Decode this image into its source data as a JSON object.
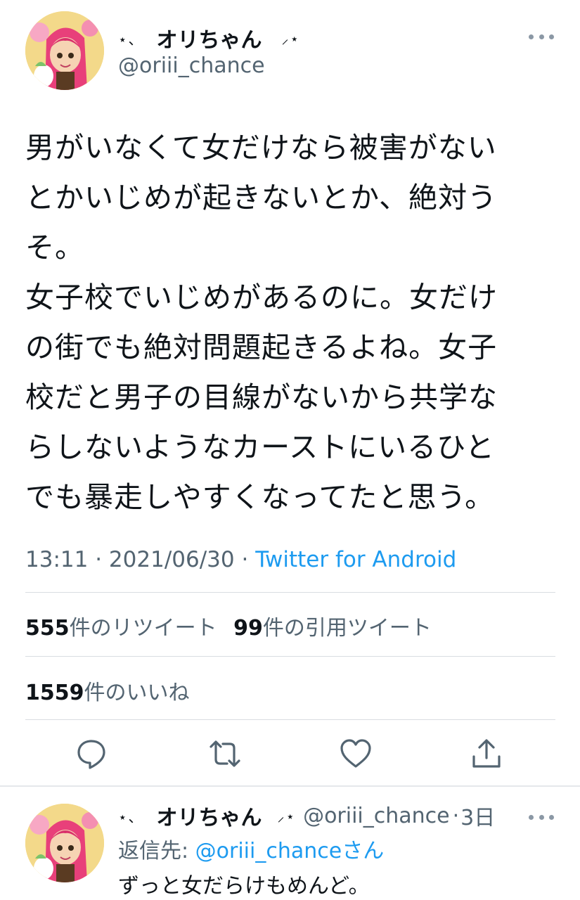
{
  "tweet": {
    "deco_left": "⋆、",
    "display_name": "オリちゃん",
    "deco_right": "⸝⋆",
    "handle": "@oriii_chance",
    "text": "男がいなくて女だけなら被害がない\nとかいじめが起きないとか、絶対う\nそ。\n女子校でいじめがあるのに。女だけ\nの街でも絶対問題起きるよね。女子\n校だと男子の目線がないから共学な\nらしないようなカーストにいるひと\nでも暴走しやすくなってたと思う。",
    "time": "13:11",
    "date": "2021/06/30",
    "dot": "·",
    "source": "Twitter for Android"
  },
  "stats": {
    "retweets_count": "555",
    "retweets_label": "件のリツイート",
    "quotes_count": "99",
    "quotes_label": "件の引用ツイート",
    "likes_count": "1559",
    "likes_label": "件のいいね"
  },
  "actions": [
    "reply-icon",
    "retweet-icon",
    "like-icon",
    "share-icon"
  ],
  "reply": {
    "deco_left": "⋆、",
    "display_name": "オリちゃん",
    "deco_right": "⸝⋆",
    "handle": "@oriii_chance",
    "dot": "·",
    "age": "3日",
    "reply_to_label": "返信先: ",
    "reply_to_handle": "@oriii_chance",
    "reply_to_suffix": "さん",
    "text": "ずっと女だらけもめんど。"
  },
  "colors": {
    "link": "#1d9bf0",
    "muted": "#536471",
    "text": "#0f1419"
  }
}
